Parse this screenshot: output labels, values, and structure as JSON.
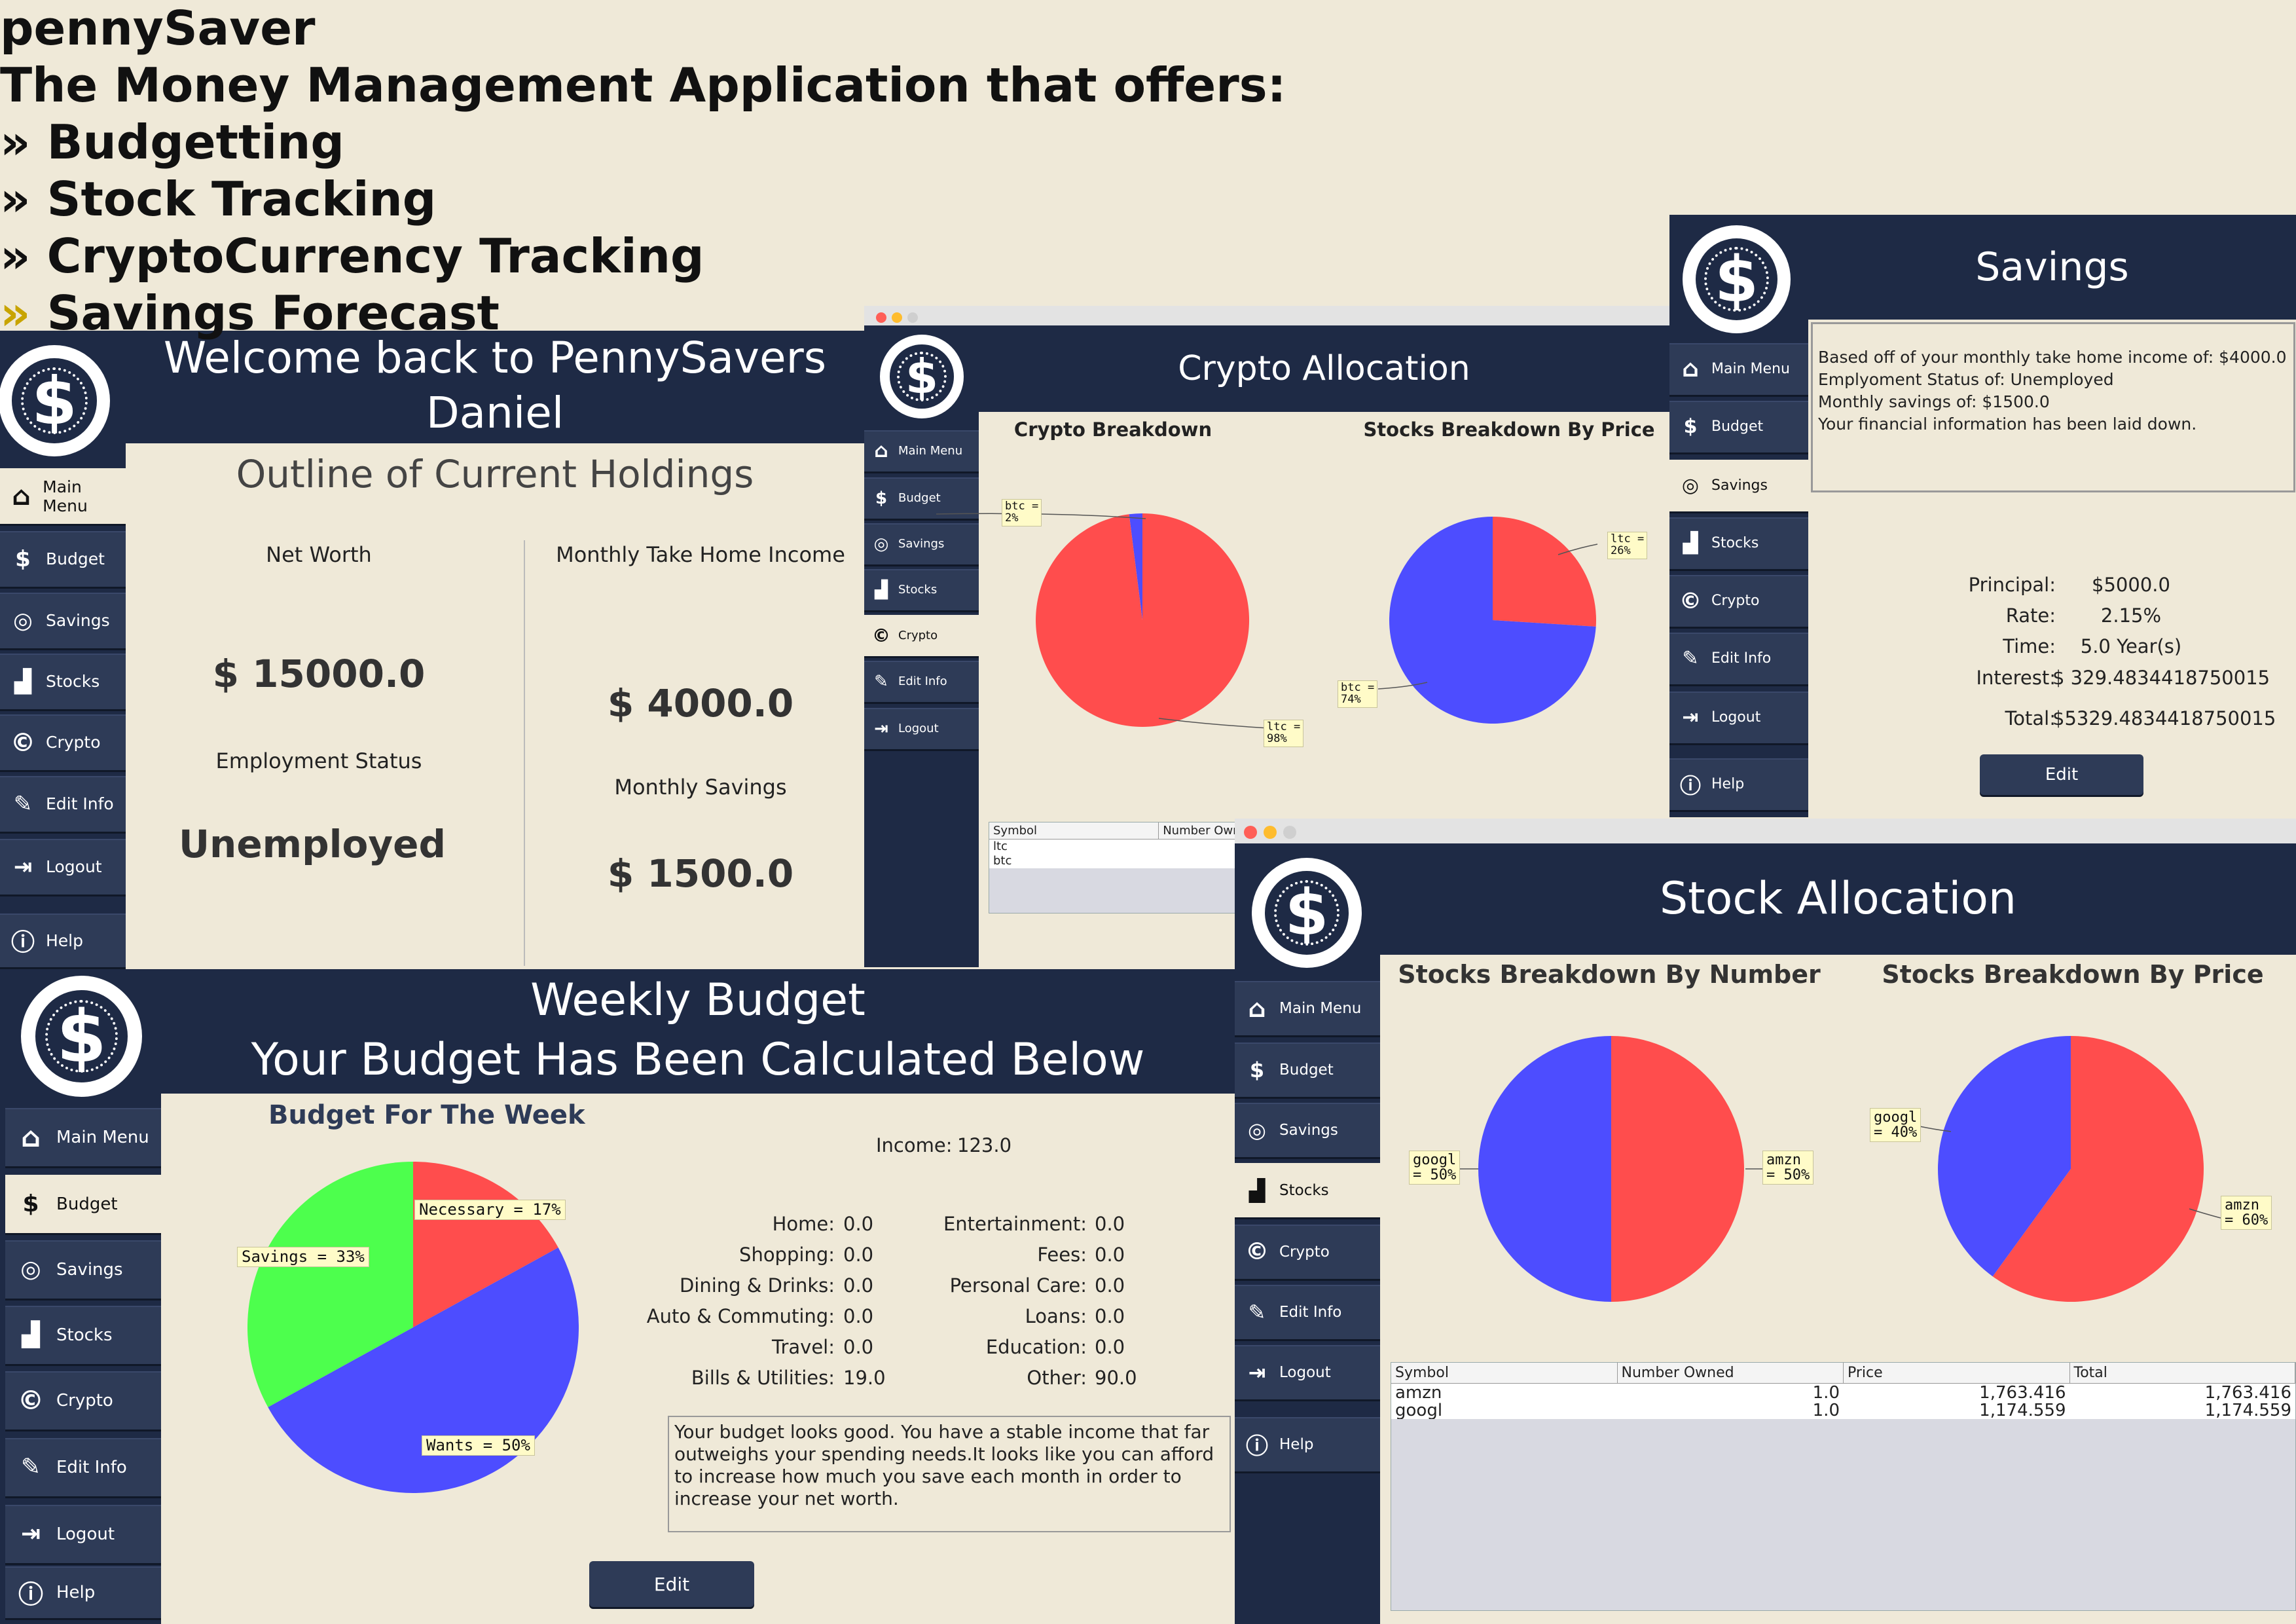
{
  "intro": {
    "app_name": "pennySaver",
    "tagline": "The Money Management Application that offers:",
    "bullet_symbol": "»",
    "features": [
      "Budgetting",
      "Stock Tracking",
      "CryptoCurrency Tracking",
      "Savings Forecast"
    ]
  },
  "nav_labels": {
    "main_menu": "Main Menu",
    "budget": "Budget",
    "savings": "Savings",
    "stocks": "Stocks",
    "crypto": "Crypto",
    "edit_info": "Edit Info",
    "logout": "Logout",
    "help": "Help"
  },
  "logo_symbol": "$",
  "colors": {
    "navy": "#1e2a45",
    "red": "#ff4d4d",
    "blue": "#4d4dff",
    "green": "#4dff4d",
    "panel": "#efe9d8"
  },
  "main_window": {
    "title_line1": "Welcome back to PennySavers",
    "title_line2": "Daniel",
    "subtitle": "Outline of Current Holdings",
    "net_worth_label": "Net Worth",
    "net_worth_value": "$ 15000.0",
    "employment_label": "Employment Status",
    "employment_value": "Unemployed",
    "income_label": "Monthly Take Home Income",
    "income_value": "$ 4000.0",
    "savings_label": "Monthly Savings",
    "savings_value": "$ 1500.0"
  },
  "crypto_window": {
    "title": "Crypto Allocation",
    "chart1_title": "Crypto Breakdown",
    "chart2_title": "Stocks Breakdown By Price",
    "pie1_labels": [
      "btc =\n2%",
      "ltc =\n98%"
    ],
    "pie2_labels": [
      "ltc =\n26%",
      "btc =\n74%"
    ],
    "table_headers": [
      "Symbol",
      "Number Owne"
    ],
    "table_rows": [
      "ltc",
      "btc"
    ]
  },
  "savings_window": {
    "title": "Savings",
    "info_lines": [
      "Based off of your monthly take home income of: $4000.0",
      "Emplyoment Status of: Unemployed",
      "Monthly savings of: $1500.0",
      "Your financial information has been laid down."
    ],
    "fields": [
      {
        "label": "Principal:",
        "value": "$5000.0"
      },
      {
        "label": "Rate:",
        "value": "2.15%"
      },
      {
        "label": "Time:",
        "value": "5.0 Year(s)"
      },
      {
        "label": "Interest:",
        "value": "$ 329.4834418750015"
      },
      {
        "label": "Total:",
        "value": "$5329.4834418750015"
      }
    ],
    "edit_button": "Edit"
  },
  "budget_window": {
    "title_line1": "Weekly Budget",
    "title_line2": "Your Budget Has Been Calculated Below",
    "chart_title": "Budget For The Week",
    "pie_labels": [
      "Necessary = 17%",
      "Savings = 33%",
      "Wants = 50%"
    ],
    "income_label": "Income:",
    "income_value": "123.0",
    "left_fields": [
      {
        "label": "Home:",
        "value": "0.0"
      },
      {
        "label": "Shopping:",
        "value": "0.0"
      },
      {
        "label": "Dining & Drinks:",
        "value": "0.0"
      },
      {
        "label": "Auto & Commuting:",
        "value": "0.0"
      },
      {
        "label": "Travel:",
        "value": "0.0"
      },
      {
        "label": "Bills & Utilities:",
        "value": "19.0"
      }
    ],
    "right_fields": [
      {
        "label": "Entertainment:",
        "value": "0.0"
      },
      {
        "label": "Fees:",
        "value": "0.0"
      },
      {
        "label": "Personal Care:",
        "value": "0.0"
      },
      {
        "label": "Loans:",
        "value": "0.0"
      },
      {
        "label": "Education:",
        "value": "0.0"
      },
      {
        "label": "Other:",
        "value": "90.0"
      }
    ],
    "message": "Your budget looks good. You have a stable income that far outweighs your spending needs.It looks like you can afford to increase how much you save each month in order to increase your net worth.",
    "edit_button": "Edit"
  },
  "stock_window": {
    "title": "Stock Allocation",
    "chart1_title": "Stocks Breakdown By Number",
    "chart2_title": "Stocks Breakdown By Price",
    "pie1_labels": [
      "googl\n= 50%",
      "amzn\n= 50%"
    ],
    "pie2_labels": [
      "googl\n= 40%",
      "amzn\n= 60%"
    ],
    "table_headers": [
      "Symbol",
      "Number Owned",
      "Price",
      "Total"
    ],
    "table_rows": [
      [
        "amzn",
        "1.0",
        "1,763.416",
        "1,763.416"
      ],
      [
        "googl",
        "1.0",
        "1,174.559",
        "1,174.559"
      ]
    ]
  },
  "chart_data": [
    {
      "type": "pie",
      "title": "Crypto Breakdown",
      "categories": [
        "btc",
        "ltc"
      ],
      "values": [
        2,
        98
      ]
    },
    {
      "type": "pie",
      "title": "Stocks Breakdown By Price",
      "categories": [
        "ltc",
        "btc"
      ],
      "values": [
        26,
        74
      ]
    },
    {
      "type": "pie",
      "title": "Budget For The Week",
      "categories": [
        "Necessary",
        "Wants",
        "Savings"
      ],
      "values": [
        17,
        50,
        33
      ]
    },
    {
      "type": "pie",
      "title": "Stocks Breakdown By Number",
      "categories": [
        "amzn",
        "googl"
      ],
      "values": [
        50,
        50
      ]
    },
    {
      "type": "pie",
      "title": "Stocks Breakdown By Price",
      "categories": [
        "amzn",
        "googl"
      ],
      "values": [
        60,
        40
      ]
    }
  ]
}
